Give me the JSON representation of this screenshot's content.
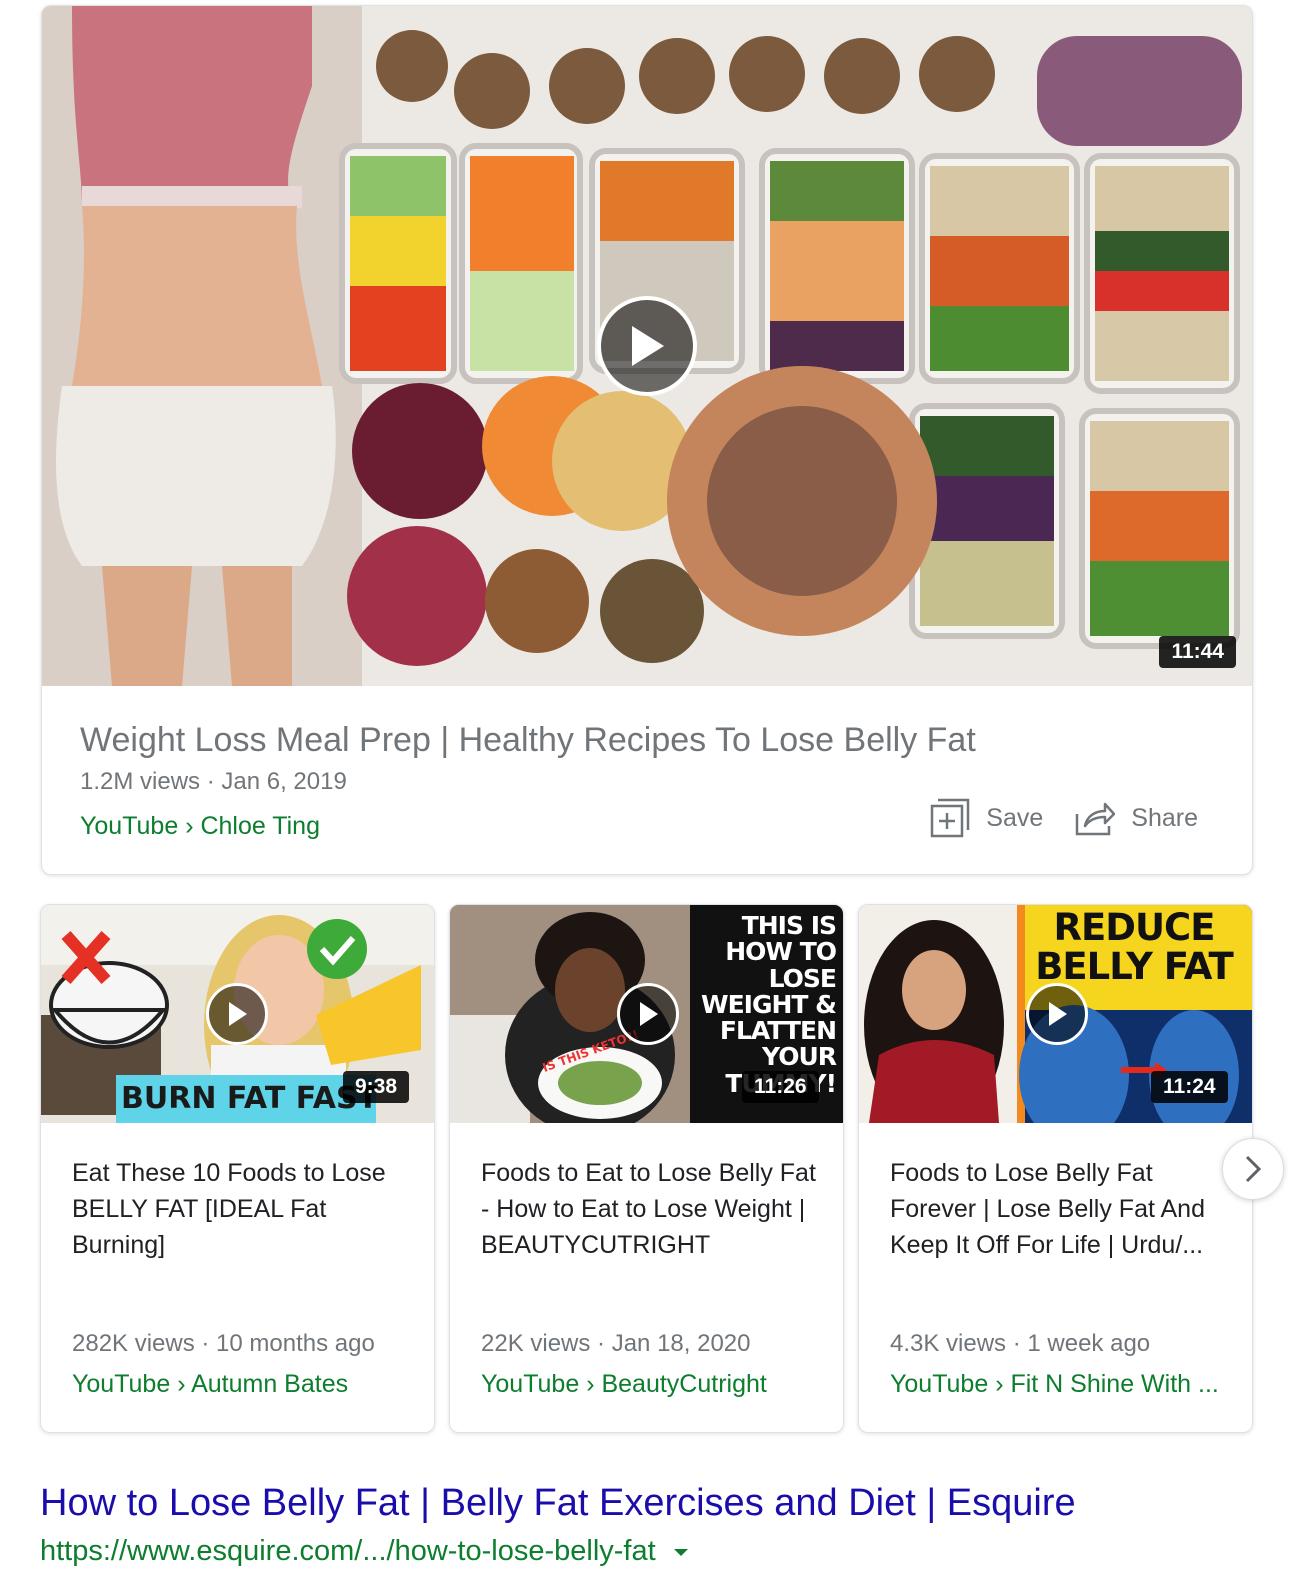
{
  "featured": {
    "title": "Weight Loss Meal Prep | Healthy Recipes To Lose Belly Fat",
    "meta": "1.2M views · Jan 6, 2019",
    "source": "YouTube › Chloe Ting",
    "duration": "11:44",
    "save_label": "Save",
    "share_label": "Share"
  },
  "videos": [
    {
      "title": "Eat These 10 Foods to Lose BELLY FAT [IDEAL Fat Burning]",
      "meta": "282K views · 10 months ago",
      "source": "YouTube › Autumn Bates",
      "duration": "9:38",
      "thumb_text": "BURN FAT FAST"
    },
    {
      "title": "Foods to Eat to Lose Belly Fat - How to Eat to Lose Weight | BEAUTYCUTRIGHT",
      "meta": "22K views · Jan 18, 2020",
      "source": "YouTube › BeautyCutright",
      "duration": "11:26",
      "thumb_text": "THIS IS HOW TO LOSE WEIGHT & FLATTEN YOUR TUMMY!",
      "thumb_subtext": "IS THIS KETO?!"
    },
    {
      "title": "Foods to Lose Belly Fat Forever | Lose Belly Fat And Keep It Off For Life | Urdu/...",
      "meta": "4.3K views · 1 week ago",
      "source": "YouTube › Fit N Shine With ...",
      "duration": "11:24",
      "thumb_text": "REDUCE BELLY FAT"
    }
  ],
  "result": {
    "title": "How to Lose Belly Fat | Belly Fat Exercises and Diet | Esquire",
    "url": "https://www.esquire.com/.../how-to-lose-belly-fat"
  },
  "colors": {
    "link": "#1a0dab",
    "source_green": "#0d7d2e",
    "meta_gray": "#70757a"
  }
}
